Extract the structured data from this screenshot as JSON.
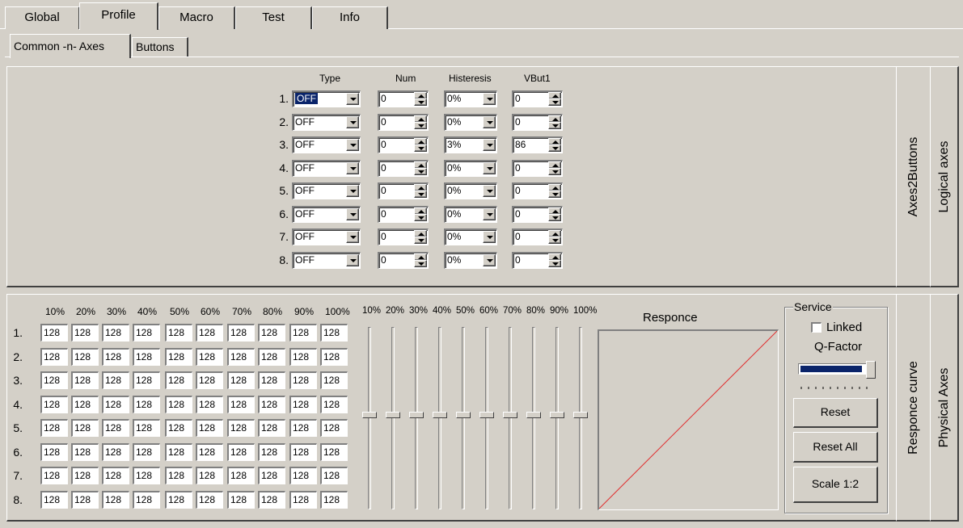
{
  "top_tabs": [
    {
      "label": "Global",
      "active": false
    },
    {
      "label": "Profile",
      "active": true
    },
    {
      "label": "Macro",
      "active": false
    },
    {
      "label": "Test",
      "active": false
    },
    {
      "label": "Info",
      "active": false
    }
  ],
  "sub_tabs": [
    {
      "label": "Common -n- Axes",
      "active": true
    },
    {
      "label": "Buttons",
      "active": false
    }
  ],
  "axes2buttons": {
    "side_tab": "Axes2Buttons",
    "outer_tab": "Logical axes",
    "headers": {
      "type": "Type",
      "num": "Num",
      "histeresis": "Histeresis",
      "vbut1": "VBut1"
    },
    "rows": [
      {
        "label": "1.",
        "type": "OFF",
        "num": "0",
        "histeresis": "0%",
        "vbut1": "0"
      },
      {
        "label": "2.",
        "type": "OFF",
        "num": "0",
        "histeresis": "0%",
        "vbut1": "0"
      },
      {
        "label": "3.",
        "type": "OFF",
        "num": "0",
        "histeresis": "3%",
        "vbut1": "86"
      },
      {
        "label": "4.",
        "type": "OFF",
        "num": "0",
        "histeresis": "0%",
        "vbut1": "0"
      },
      {
        "label": "5.",
        "type": "OFF",
        "num": "0",
        "histeresis": "0%",
        "vbut1": "0"
      },
      {
        "label": "6.",
        "type": "OFF",
        "num": "0",
        "histeresis": "0%",
        "vbut1": "0"
      },
      {
        "label": "7.",
        "type": "OFF",
        "num": "0",
        "histeresis": "0%",
        "vbut1": "0"
      },
      {
        "label": "8.",
        "type": "OFF",
        "num": "0",
        "histeresis": "0%",
        "vbut1": "0"
      }
    ]
  },
  "response_curve": {
    "side_tab": "Responce curve",
    "outer_tab": "Physical Axes",
    "columns": [
      "10%",
      "20%",
      "30%",
      "40%",
      "50%",
      "60%",
      "70%",
      "80%",
      "90%",
      "100%"
    ],
    "rows": [
      {
        "label": "1.",
        "values": [
          "128",
          "128",
          "128",
          "128",
          "128",
          "128",
          "128",
          "128",
          "128",
          "128"
        ]
      },
      {
        "label": "2.",
        "values": [
          "128",
          "128",
          "128",
          "128",
          "128",
          "128",
          "128",
          "128",
          "128",
          "128"
        ]
      },
      {
        "label": "3.",
        "values": [
          "128",
          "128",
          "128",
          "128",
          "128",
          "128",
          "128",
          "128",
          "128",
          "128"
        ]
      },
      {
        "label": "4.",
        "values": [
          "128",
          "128",
          "128",
          "128",
          "128",
          "128",
          "128",
          "128",
          "128",
          "128"
        ]
      },
      {
        "label": "5.",
        "values": [
          "128",
          "128",
          "128",
          "128",
          "128",
          "128",
          "128",
          "128",
          "128",
          "128"
        ]
      },
      {
        "label": "6.",
        "values": [
          "128",
          "128",
          "128",
          "128",
          "128",
          "128",
          "128",
          "128",
          "128",
          "128"
        ]
      },
      {
        "label": "7.",
        "values": [
          "128",
          "128",
          "128",
          "128",
          "128",
          "128",
          "128",
          "128",
          "128",
          "128"
        ]
      },
      {
        "label": "8.",
        "values": [
          "128",
          "128",
          "128",
          "128",
          "128",
          "128",
          "128",
          "128",
          "128",
          "128"
        ]
      }
    ],
    "slider_labels": [
      "10%",
      "20%",
      "30%",
      "40%",
      "50%",
      "60%",
      "70%",
      "80%",
      "90%",
      "100%"
    ],
    "slider_values": [
      0.5,
      0.5,
      0.5,
      0.5,
      0.5,
      0.5,
      0.5,
      0.5,
      0.5,
      0.5
    ],
    "graph_title": "Responce",
    "graph_line_color": "#e03030"
  },
  "service": {
    "title": "Service",
    "linked_label": "Linked",
    "linked_checked": false,
    "qfactor_label": "Q-Factor",
    "qfactor_value": 1.0,
    "reset_label": "Reset",
    "reset_all_label": "Reset All",
    "scale_label": "Scale 1:2"
  },
  "colors": {
    "face": "#d4d0c8",
    "selection": "#0a246a",
    "slider_fill": "#0a246a"
  }
}
